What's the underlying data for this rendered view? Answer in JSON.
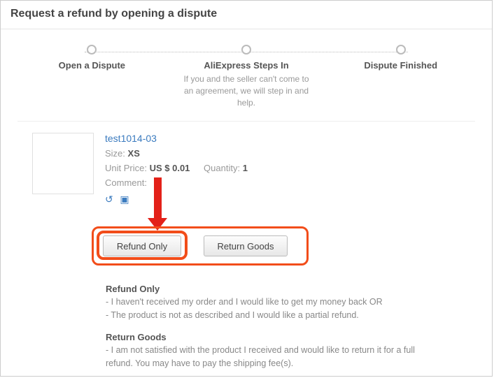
{
  "header": {
    "title": "Request a refund by opening a dispute"
  },
  "steps": {
    "s1": {
      "label": "Open a Dispute"
    },
    "s2": {
      "label": "AliExpress Steps In",
      "sublabel": "If you and the seller can't come to an agreement, we will step in and help."
    },
    "s3": {
      "label": "Dispute Finished"
    }
  },
  "product": {
    "name": "test1014-03",
    "size_label": "Size:",
    "size_value": "XS",
    "unit_price_label": "Unit Price:",
    "unit_price_value": "US $ 0.01",
    "quantity_label": "Quantity:",
    "quantity_value": "1",
    "comment_label": "Comment:"
  },
  "actions": {
    "refund_only_label": "Refund Only",
    "return_goods_label": "Return Goods"
  },
  "descriptions": {
    "refund": {
      "title": "Refund Only",
      "line1": "- I haven't received my order and I would like to get my money back OR",
      "line2": "- The product is not as described and I would like a partial refund."
    },
    "return": {
      "title": "Return Goods",
      "line1": "- I am not satisfied with the product I received and would like to return it for a full refund. You may have to pay the shipping fee(s)."
    }
  }
}
